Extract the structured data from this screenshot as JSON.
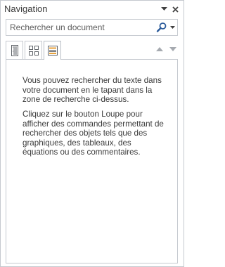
{
  "pane": {
    "title": "Navigation",
    "dropdown_icon": "chevron-down-icon",
    "close_icon": "close-icon"
  },
  "search": {
    "placeholder": "Rechercher un document",
    "value": "",
    "button_icon": "magnifier-icon",
    "dropdown_icon": "chevron-down-icon"
  },
  "tabs": [
    {
      "icon": "headings-icon",
      "selected": false
    },
    {
      "icon": "thumbnails-icon",
      "selected": false
    },
    {
      "icon": "results-icon",
      "selected": true
    }
  ],
  "nav": {
    "previous_icon": "triangle-up-icon",
    "next_icon": "triangle-down-icon"
  },
  "content": {
    "paragraph1": "Vous pouvez rechercher du texte dans votre document en le tapant dans la zone de recherche ci-dessus.",
    "paragraph2": "Cliquez sur le bouton Loupe pour afficher des commandes permettant de rechercher des objets tels que des graphiques, des tableaux, des équations ou des commentaires."
  },
  "colors": {
    "border": "#c5c9cf",
    "icon_gray": "#5f6368",
    "magnifier_blue": "#2a5a9a",
    "results_tab_orange": "#e8a33c",
    "nav_arrow_gray": "#a6aab0"
  }
}
